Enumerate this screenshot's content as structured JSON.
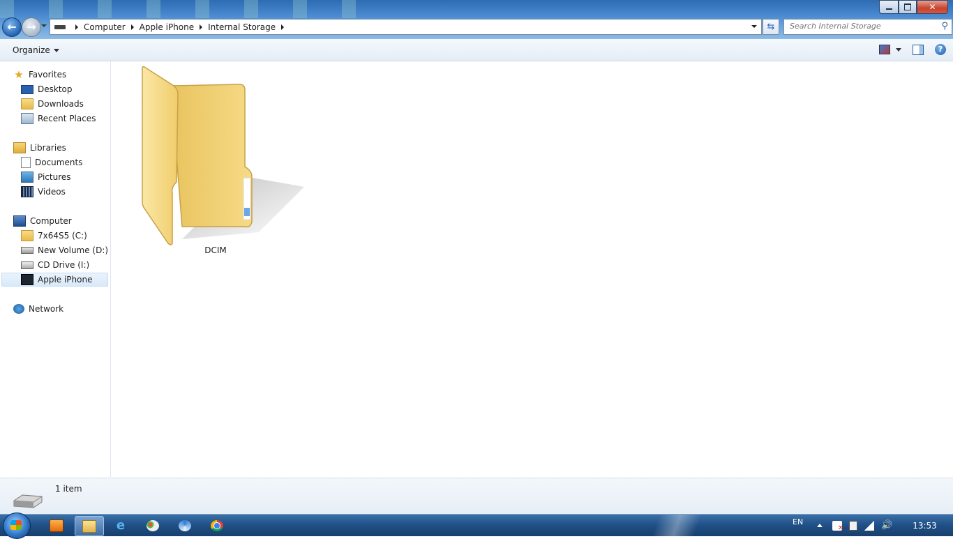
{
  "address": {
    "crumbs": [
      "Computer",
      "Apple iPhone",
      "Internal Storage"
    ]
  },
  "search": {
    "placeholder": "Search Internal Storage"
  },
  "commandbar": {
    "organize_label": "Organize"
  },
  "navpane": {
    "favorites": {
      "label": "Favorites",
      "items": [
        "Desktop",
        "Downloads",
        "Recent Places"
      ]
    },
    "libraries": {
      "label": "Libraries",
      "items": [
        "Documents",
        "Pictures",
        "Videos"
      ]
    },
    "computer": {
      "label": "Computer",
      "items": [
        "7x64S5 (C:)",
        "New Volume (D:)",
        "CD Drive (I:)",
        "Apple iPhone"
      ]
    },
    "network": {
      "label": "Network"
    },
    "selected": "Apple iPhone"
  },
  "content": {
    "items": [
      {
        "name": "DCIM",
        "type": "folder"
      }
    ]
  },
  "status": {
    "count": "1 item"
  },
  "taskbar": {
    "language": "EN",
    "clock": "13:53",
    "pinned": [
      "media-player-icon",
      "explorer-icon",
      "internet-explorer-icon",
      "paint-icon",
      "app-icon",
      "chrome-icon"
    ]
  },
  "colors": {
    "accent": "#2d6bb3",
    "folder": "#f1cf6e",
    "selection": "#d9e9f9",
    "taskbar": "#1f4f86"
  }
}
